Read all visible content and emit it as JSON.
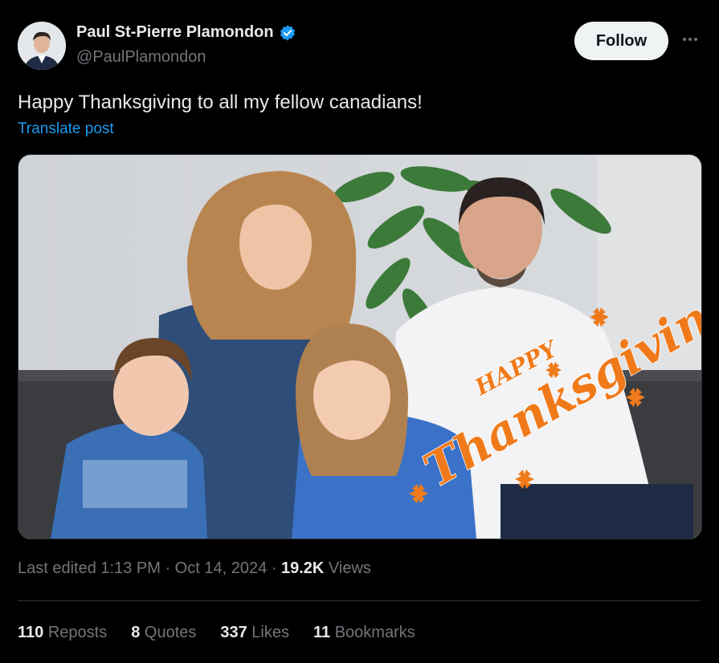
{
  "author": {
    "name": "Paul St-Pierre Plamondon",
    "handle": "@PaulPlamondon",
    "verified": true
  },
  "follow_label": "Follow",
  "post": {
    "text": "Happy Thanksgiving to all my fellow canadians!",
    "translate_label": "Translate post"
  },
  "image": {
    "overlay_happy": "HAPPY",
    "overlay_thanksgiving": "Thanksgiving"
  },
  "meta": {
    "edited_prefix": "Last edited 1:13 PM · Oct 14, 2024 · ",
    "views_count": "19.2K",
    "views_label": " Views"
  },
  "stats": {
    "reposts_count": "110",
    "reposts_label": " Reposts",
    "quotes_count": "8",
    "quotes_label": " Quotes",
    "likes_count": "337",
    "likes_label": " Likes",
    "bookmarks_count": "11",
    "bookmarks_label": " Bookmarks"
  },
  "colors": {
    "accent": "#1d9bf0",
    "background": "#000000",
    "overlay_orange": "#f07a1a"
  }
}
